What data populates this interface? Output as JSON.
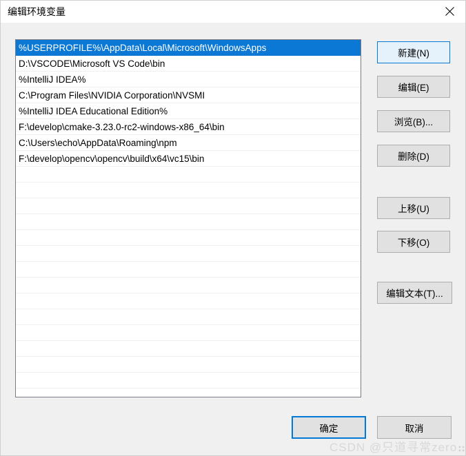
{
  "window": {
    "title": "编辑环境变量",
    "close_icon": "close-icon"
  },
  "path_list": {
    "selected_index": 0,
    "items": [
      "%USERPROFILE%\\AppData\\Local\\Microsoft\\WindowsApps",
      "D:\\VSCODE\\Microsoft VS Code\\bin",
      "%IntelliJ IDEA%",
      "C:\\Program Files\\NVIDIA Corporation\\NVSMI",
      "%IntelliJ IDEA Educational Edition%",
      "F:\\develop\\cmake-3.23.0-rc2-windows-x86_64\\bin",
      "C:\\Users\\echo\\AppData\\Roaming\\npm",
      "F:\\develop\\opencv\\opencv\\build\\x64\\vc15\\bin"
    ],
    "empty_row_count": 14
  },
  "side_buttons": {
    "new": "新建(N)",
    "edit": "编辑(E)",
    "browse": "浏览(B)...",
    "delete": "删除(D)",
    "move_up": "上移(U)",
    "move_down": "下移(O)",
    "edit_text": "编辑文本(T)..."
  },
  "bottom_buttons": {
    "ok": "确定",
    "cancel": "取消"
  },
  "watermark": {
    "text": "CSDN @只道寻常zero"
  },
  "colors": {
    "selection_blue": "#0a78d4",
    "focus_blue": "#0078d7",
    "focus_fill": "#e5f1fb",
    "button_face": "#e1e1e1",
    "dialog_background": "#f0f0f0",
    "titlebar_background": "#ffffff",
    "list_background": "#ffffff",
    "list_border": "#7a7a85",
    "watermark_gray": "#d8d8d8"
  }
}
